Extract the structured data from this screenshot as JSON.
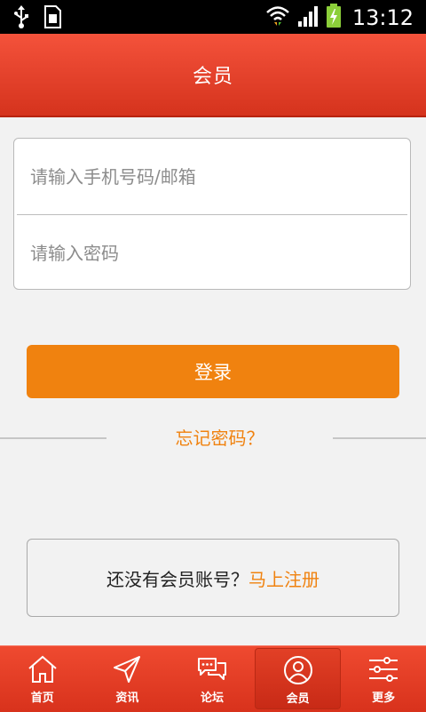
{
  "status_bar": {
    "time": "13:12"
  },
  "header": {
    "title": "会员"
  },
  "login_form": {
    "account_placeholder": "请输入手机号码/邮箱",
    "password_placeholder": "请输入密码"
  },
  "login_button": {
    "label": "登录"
  },
  "forgot": {
    "label": "忘记密码？"
  },
  "register": {
    "prompt": "还没有会员账号？",
    "link": "马上注册"
  },
  "bottom_nav": {
    "items": [
      {
        "label": "首页",
        "icon": "home-icon"
      },
      {
        "label": "资讯",
        "icon": "send-icon"
      },
      {
        "label": "论坛",
        "icon": "chat-icon"
      },
      {
        "label": "会员",
        "icon": "user-icon",
        "active": true
      },
      {
        "label": "更多",
        "icon": "sliders-icon"
      }
    ]
  },
  "colors": {
    "accent": "#f0820f",
    "header": "#e5412a"
  }
}
